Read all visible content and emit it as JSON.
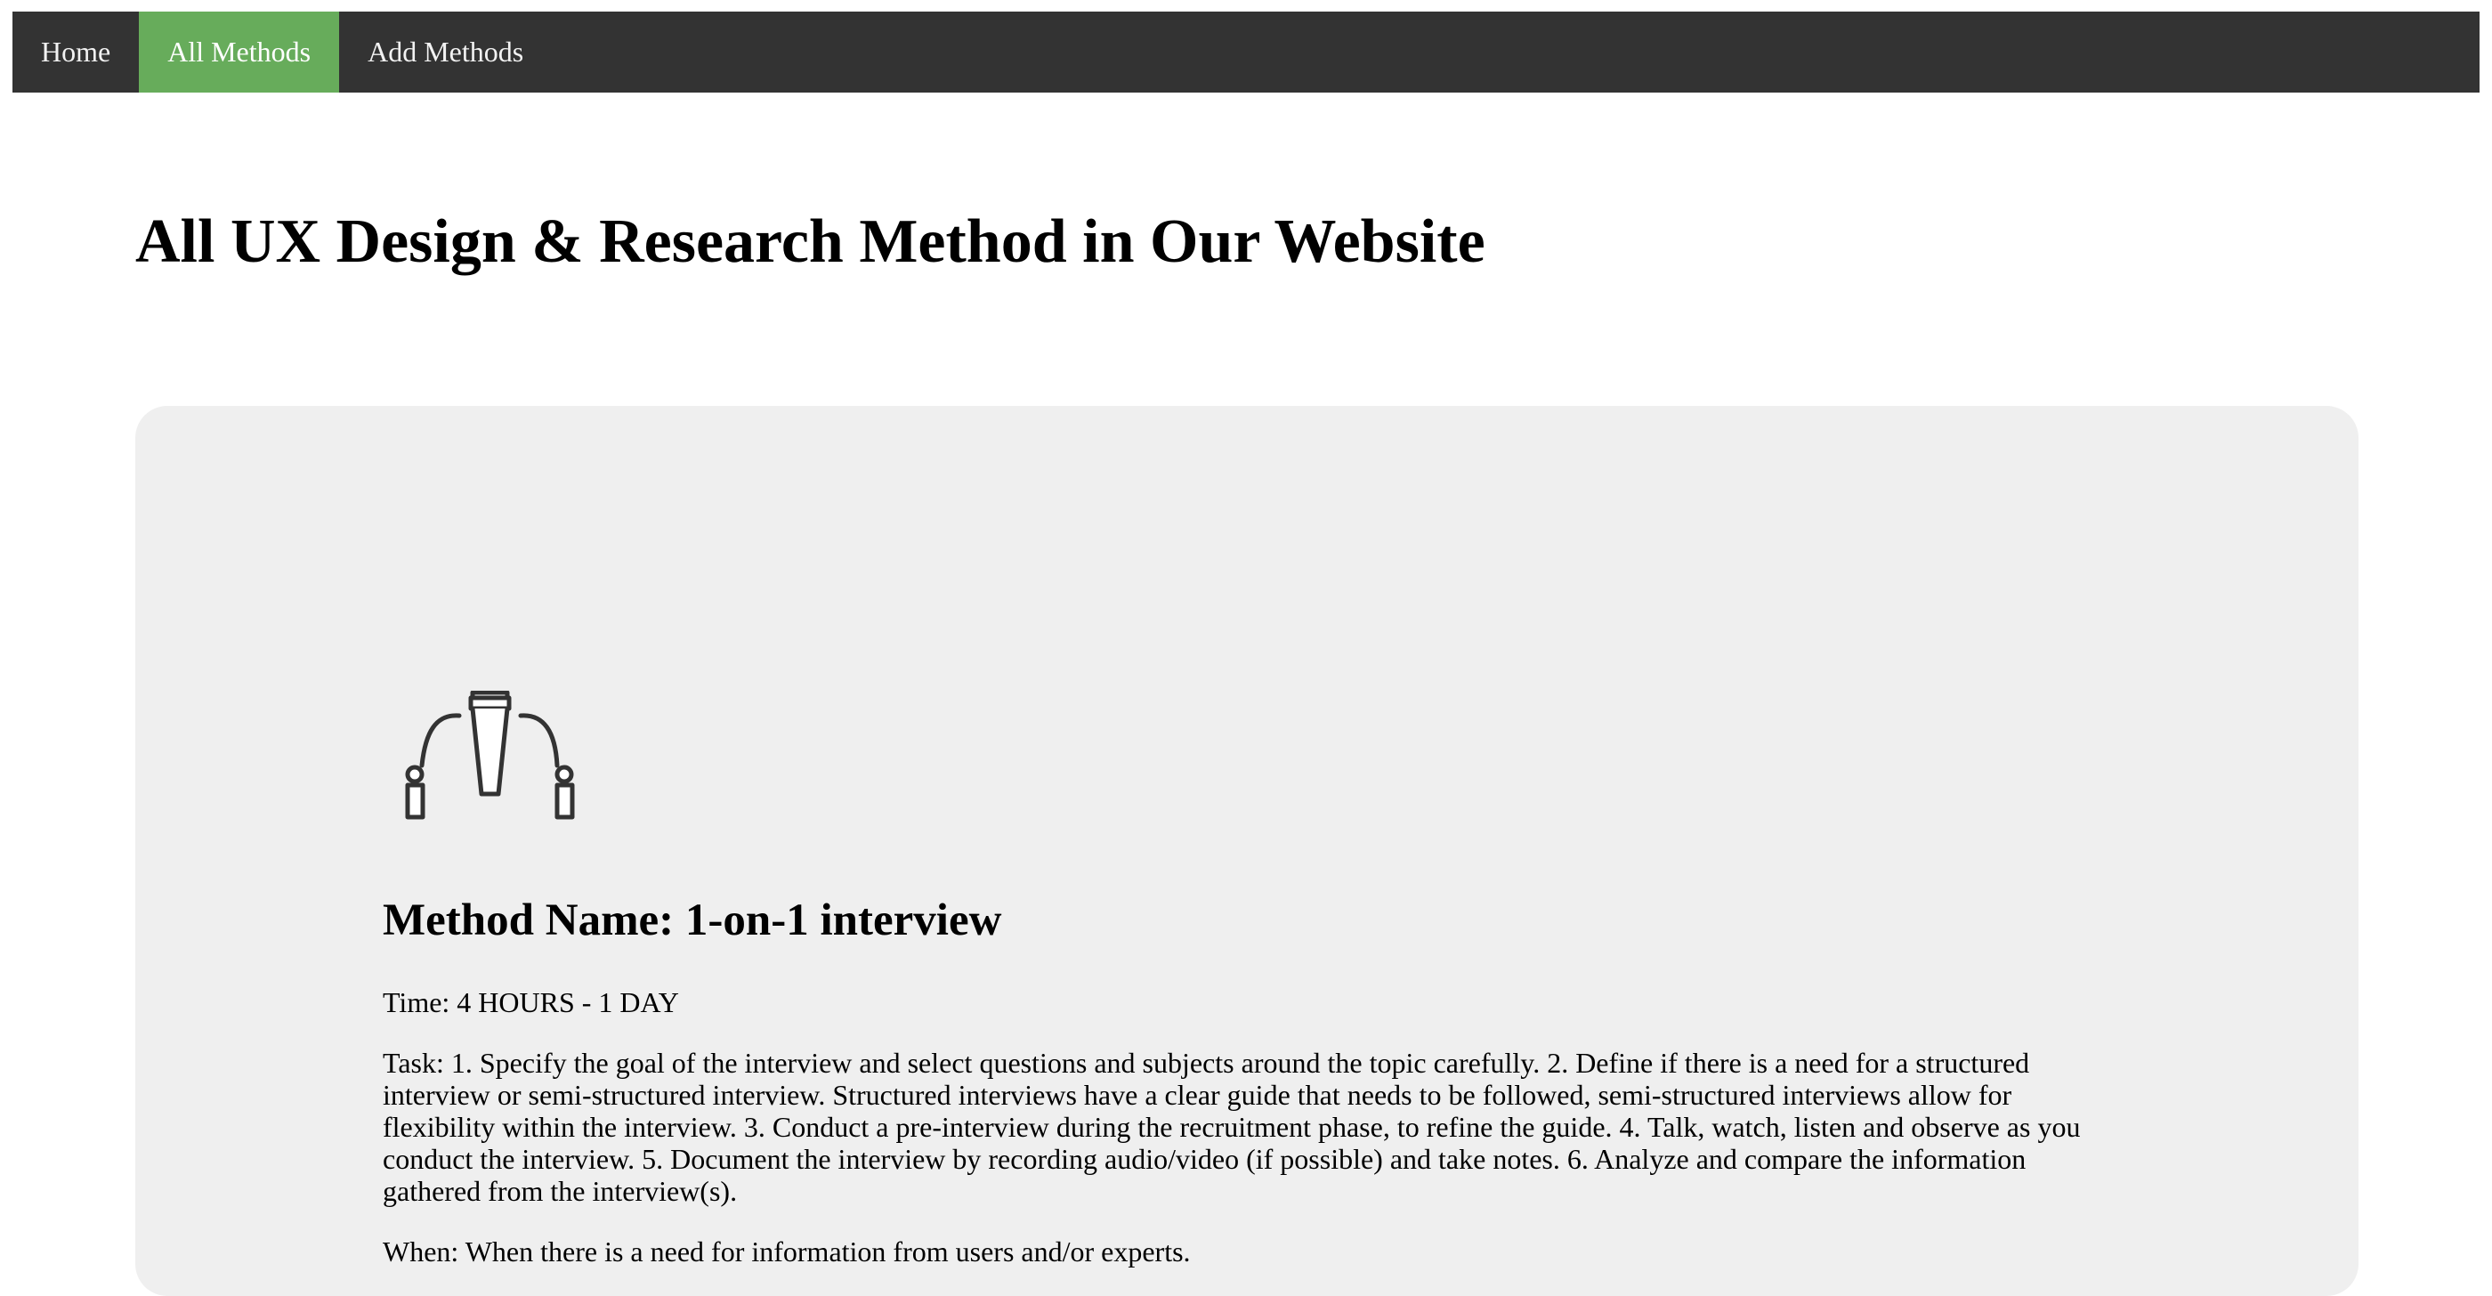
{
  "nav": {
    "items": [
      {
        "label": "Home",
        "active": false
      },
      {
        "label": "All Methods",
        "active": true
      },
      {
        "label": "Add Methods",
        "active": false
      }
    ]
  },
  "page": {
    "title": "All UX Design & Research Method in Our Website"
  },
  "method": {
    "icon": "interview-microphone-icon",
    "name": "Method Name: 1-on-1 interview",
    "time": "Time: 4 HOURS - 1 DAY",
    "task": "Task: 1. Specify the goal of the interview and select questions and subjects around the topic carefully. 2. Define if there is a need for a structured interview or semi-structured interview. Structured interviews have a clear guide that needs to be followed, semi-structured interviews allow for flexibility within the interview. 3. Conduct a pre-interview during the recruitment phase, to refine the guide. 4. Talk, watch, listen and observe as you conduct the interview. 5. Document the interview by recording audio/video (if possible) and take notes. 6. Analyze and compare the information gathered from the interview(s).",
    "when": "When: When there is a need for information from users and/or experts."
  },
  "colors": {
    "nav_background": "#333333",
    "nav_active": "#67ac5b",
    "nav_text": "#f2f2f2",
    "card_background": "#efefef"
  }
}
